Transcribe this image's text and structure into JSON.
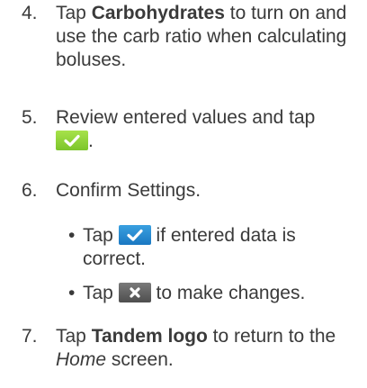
{
  "steps": {
    "s4": {
      "num": "4.",
      "pre": "Tap ",
      "bold": "Carbohydrates",
      "post": " to turn on and use the carb ratio when calculating boluses."
    },
    "s5": {
      "num": "5.",
      "text": "Review entered values and tap",
      "after": "."
    },
    "s6": {
      "num": "6.",
      "text": "Confirm Settings.",
      "bullets": [
        {
          "mark": "•",
          "pre": "Tap ",
          "post": " if entered data is correct."
        },
        {
          "mark": "•",
          "pre": "Tap ",
          "post": " to make changes."
        }
      ]
    },
    "s7": {
      "num": "7.",
      "pre": "Tap ",
      "bold": "Tandem logo",
      "mid": " to return to the",
      "italic": "Home",
      "post": " screen."
    }
  },
  "icons": {
    "green_check": "check-icon",
    "blue_check": "check-icon",
    "gray_x": "close-icon"
  },
  "colors": {
    "text": "#3a3a3a",
    "green": "#8fd13a",
    "blue": "#2a8ed4",
    "gray": "#5a5a5a"
  }
}
